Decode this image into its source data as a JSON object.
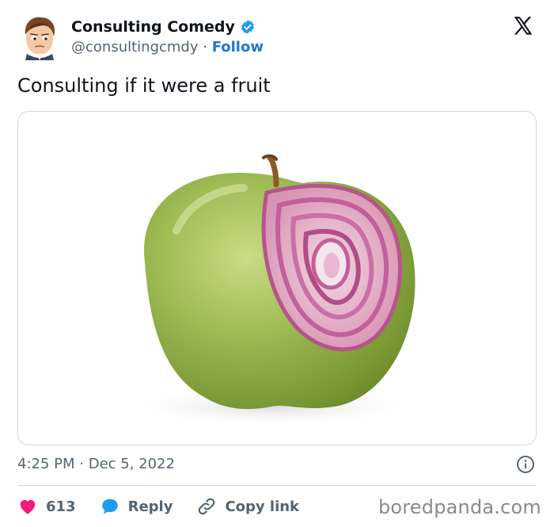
{
  "author": {
    "display_name": "Consulting Comedy",
    "handle": "@consultingcmdy",
    "separator": " · ",
    "follow_label": "Follow"
  },
  "tweet": {
    "text": "Consulting if it were a fruit",
    "time": "4:25 PM",
    "date_separator": " · ",
    "date": "Dec 5, 2022"
  },
  "actions": {
    "likes": "613",
    "reply_label": "Reply",
    "copy_link_label": "Copy link"
  },
  "watermark": "boredpanda.com",
  "icons": {
    "platform_logo": "x-logo-icon",
    "verified": "verified-badge-icon",
    "info": "info-icon",
    "like": "heart-icon",
    "reply": "speech-bubble-icon",
    "copy_link": "link-icon"
  },
  "colors": {
    "link_blue": "#1d77d2",
    "verified_blue": "#1d9bf0",
    "heart_pink": "#f91880",
    "secondary_text": "#536471",
    "border": "#cfd9de"
  }
}
